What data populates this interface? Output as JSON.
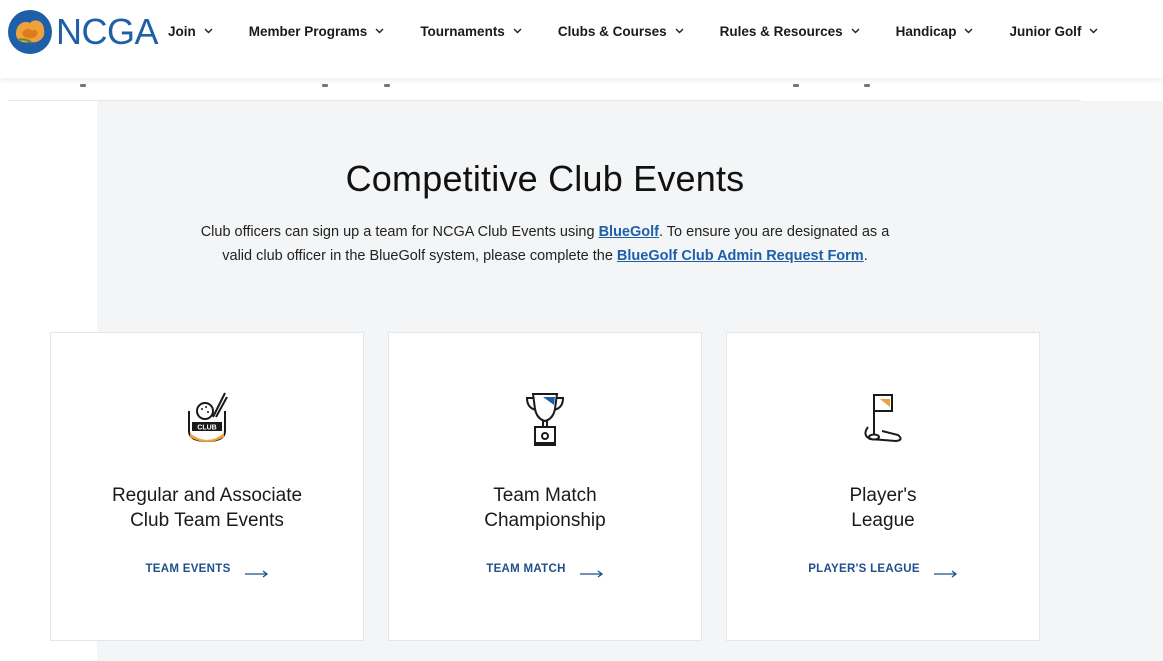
{
  "brand": {
    "name": "NCGA",
    "color": "#1f5fa8",
    "accent": "#f0a23a"
  },
  "nav": {
    "items": [
      {
        "label": "Join"
      },
      {
        "label": "Member Programs"
      },
      {
        "label": "Tournaments"
      },
      {
        "label": "Clubs & Courses"
      },
      {
        "label": "Rules & Resources"
      },
      {
        "label": "Handicap"
      },
      {
        "label": "Junior Golf"
      }
    ]
  },
  "section": {
    "title": "Competitive Club Events",
    "intro_part1": "Club officers can sign up a team for NCGA Club Events using ",
    "intro_link1": "BlueGolf",
    "intro_part2": ". To ensure you are designated as a valid club officer in the BlueGolf system, please complete the ",
    "intro_link2": "BlueGolf Club Admin Request Form",
    "intro_part3": "."
  },
  "cards": [
    {
      "icon": "club-ball-icon",
      "title_line1": "Regular and Associate",
      "title_line2": "Club Team Events",
      "link_label": "TEAM EVENTS"
    },
    {
      "icon": "trophy-icon",
      "title_line1": "Team Match",
      "title_line2": "Championship",
      "link_label": "TEAM MATCH"
    },
    {
      "icon": "flag-hole-icon",
      "title_line1": "Player's",
      "title_line2": "League",
      "link_label": "PLAYER'S LEAGUE"
    }
  ]
}
